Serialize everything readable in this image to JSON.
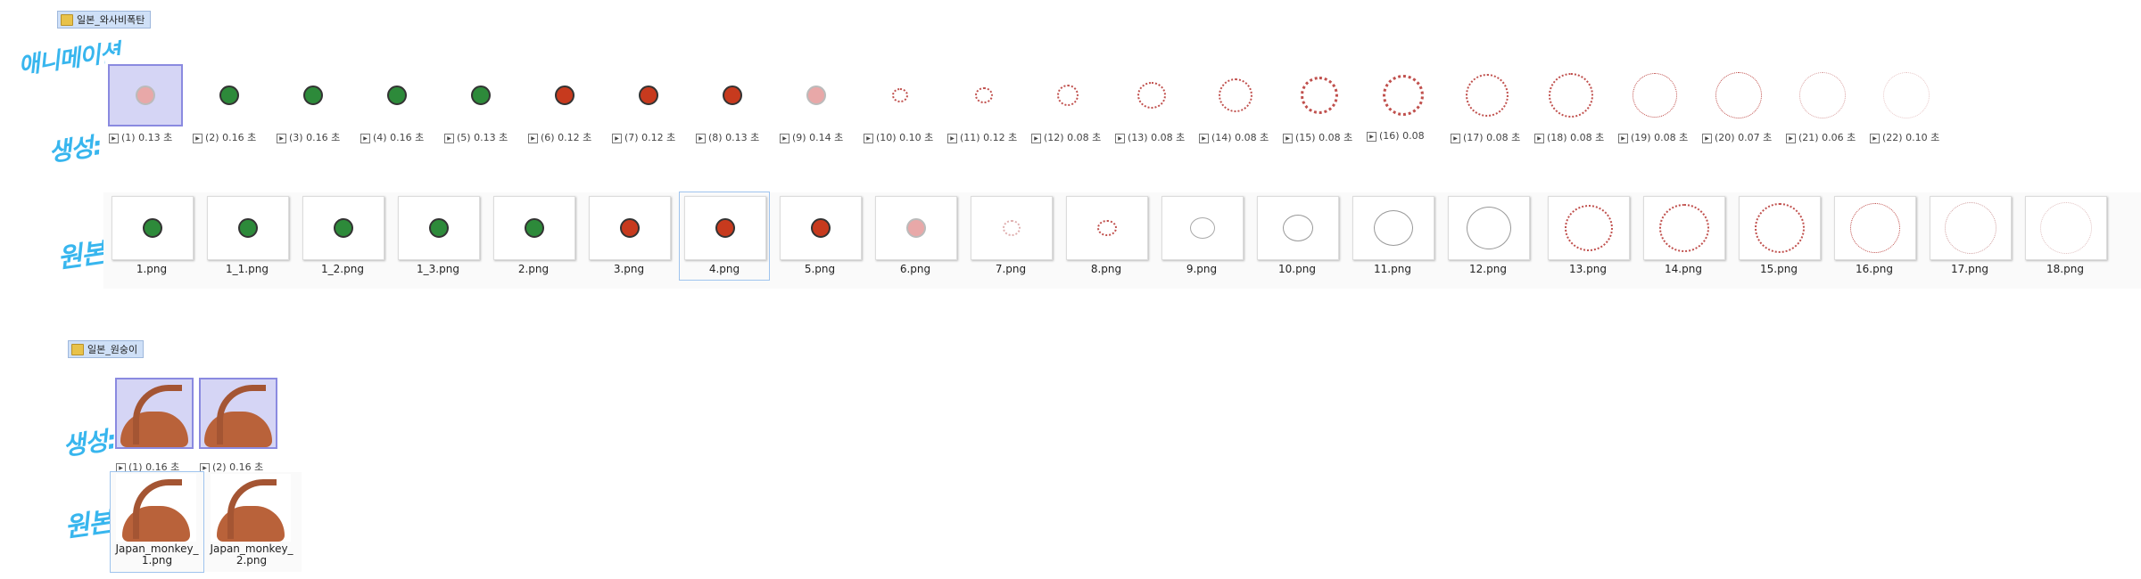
{
  "folder1": {
    "label": "일본_와사비폭탄"
  },
  "folder2": {
    "label": "일본_원숭이"
  },
  "annotations": {
    "animation": "애니메이션",
    "frames": "생성:",
    "files": "원본"
  },
  "animation1_frames": [
    {
      "index": "(1)",
      "duration": "0.13 초",
      "selected": true
    },
    {
      "index": "(2)",
      "duration": "0.16 초"
    },
    {
      "index": "(3)",
      "duration": "0.16 초"
    },
    {
      "index": "(4)",
      "duration": "0.16 초"
    },
    {
      "index": "(5)",
      "duration": "0.13 초"
    },
    {
      "index": "(6)",
      "duration": "0.12 초"
    },
    {
      "index": "(7)",
      "duration": "0.12 초"
    },
    {
      "index": "(8)",
      "duration": "0.13 초"
    },
    {
      "index": "(9)",
      "duration": "0.14 초"
    },
    {
      "index": "(10)",
      "duration": "0.10 초"
    },
    {
      "index": "(11)",
      "duration": "0.12 초"
    },
    {
      "index": "(12)",
      "duration": "0.08 초"
    },
    {
      "index": "(13)",
      "duration": "0.08 초"
    },
    {
      "index": "(14)",
      "duration": "0.08 초"
    },
    {
      "index": "(15)",
      "duration": "0.08 초"
    },
    {
      "index": "(16)",
      "duration": "0.08"
    },
    {
      "index": "(17)",
      "duration": "0.08 초"
    },
    {
      "index": "(18)",
      "duration": "0.08 초"
    },
    {
      "index": "(19)",
      "duration": "0.08 초"
    },
    {
      "index": "(20)",
      "duration": "0.07 초"
    },
    {
      "index": "(21)",
      "duration": "0.06 초"
    },
    {
      "index": "(22)",
      "duration": "0.10 초"
    }
  ],
  "animation1_files": [
    {
      "name": "1.png"
    },
    {
      "name": "1_1.png"
    },
    {
      "name": "1_2.png"
    },
    {
      "name": "1_3.png"
    },
    {
      "name": "2.png"
    },
    {
      "name": "3.png"
    },
    {
      "name": "4.png",
      "selected": true
    },
    {
      "name": "5.png"
    },
    {
      "name": "6.png"
    },
    {
      "name": "7.png"
    },
    {
      "name": "8.png"
    },
    {
      "name": "9.png"
    },
    {
      "name": "10.png"
    },
    {
      "name": "11.png"
    },
    {
      "name": "12.png"
    },
    {
      "name": "13.png"
    },
    {
      "name": "14.png"
    },
    {
      "name": "15.png"
    },
    {
      "name": "16.png"
    },
    {
      "name": "17.png"
    },
    {
      "name": "18.png"
    }
  ],
  "animation2_frames": [
    {
      "index": "(1)",
      "duration": "0.16 초",
      "selected": true
    },
    {
      "index": "(2)",
      "duration": "0.16 초",
      "selected": true
    }
  ],
  "animation2_files": [
    {
      "name": "Japan_monkey_1.png",
      "selected": true
    },
    {
      "name": "Japan_monkey_2.png"
    }
  ],
  "colors": {
    "annotation": "#38b6ee",
    "selection": "#8a8ae0",
    "folder_tag": "#cfe0f7"
  }
}
